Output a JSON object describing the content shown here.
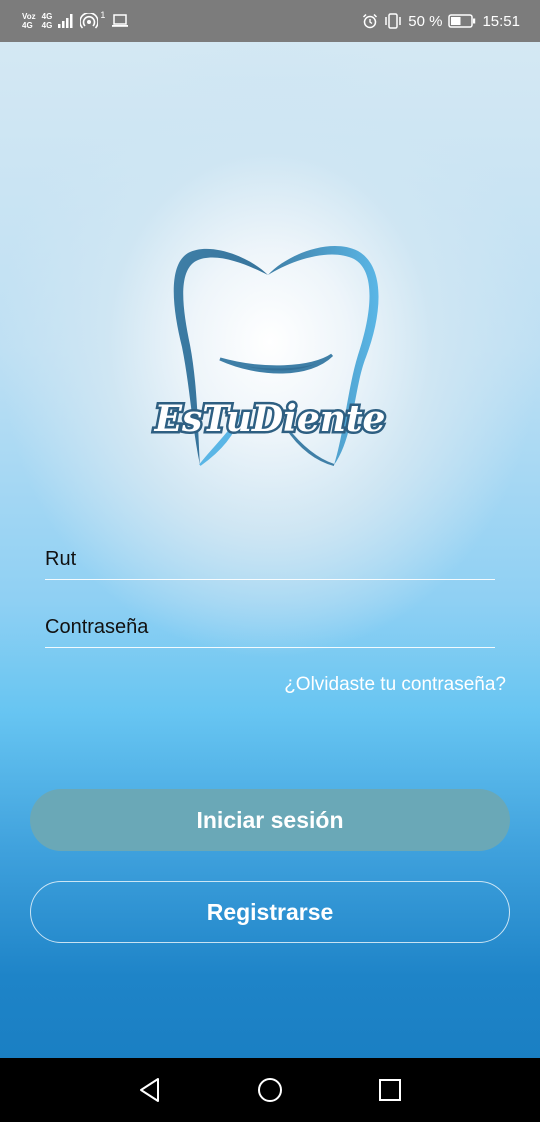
{
  "status_bar": {
    "carrier_top": "Voz",
    "carrier_bottom": "4G",
    "net_top": "4G",
    "net_bottom": "4G",
    "hotspot_count": "1",
    "battery_percent": "50 %",
    "battery_level": 0.5,
    "time": "15:51",
    "icons": [
      "signal-icon",
      "hotspot-icon",
      "laptop-icon",
      "alarm-icon",
      "vibrate-icon",
      "battery-icon"
    ]
  },
  "logo": {
    "brand_name": "EsTuDiente",
    "icon": "tooth-logo-icon",
    "colors": {
      "dark_blue": "#3f7fa7",
      "light_blue": "#5ab6e6"
    }
  },
  "form": {
    "rut_placeholder": "Rut",
    "password_placeholder": "Contraseña",
    "forgot_label": "¿Olvidaste tu contraseña?"
  },
  "buttons": {
    "login_label": "Iniciar sesión",
    "register_label": "Registrarse"
  },
  "nav_bar": {
    "icons": [
      "back-icon",
      "home-icon",
      "recents-icon"
    ]
  },
  "colors": {
    "status_bar_bg": "#7c7c7c",
    "login_button_bg": "#6aa8b7",
    "nav_bar_bg": "#000000",
    "bottom_gradient": "#1a7fc3"
  }
}
